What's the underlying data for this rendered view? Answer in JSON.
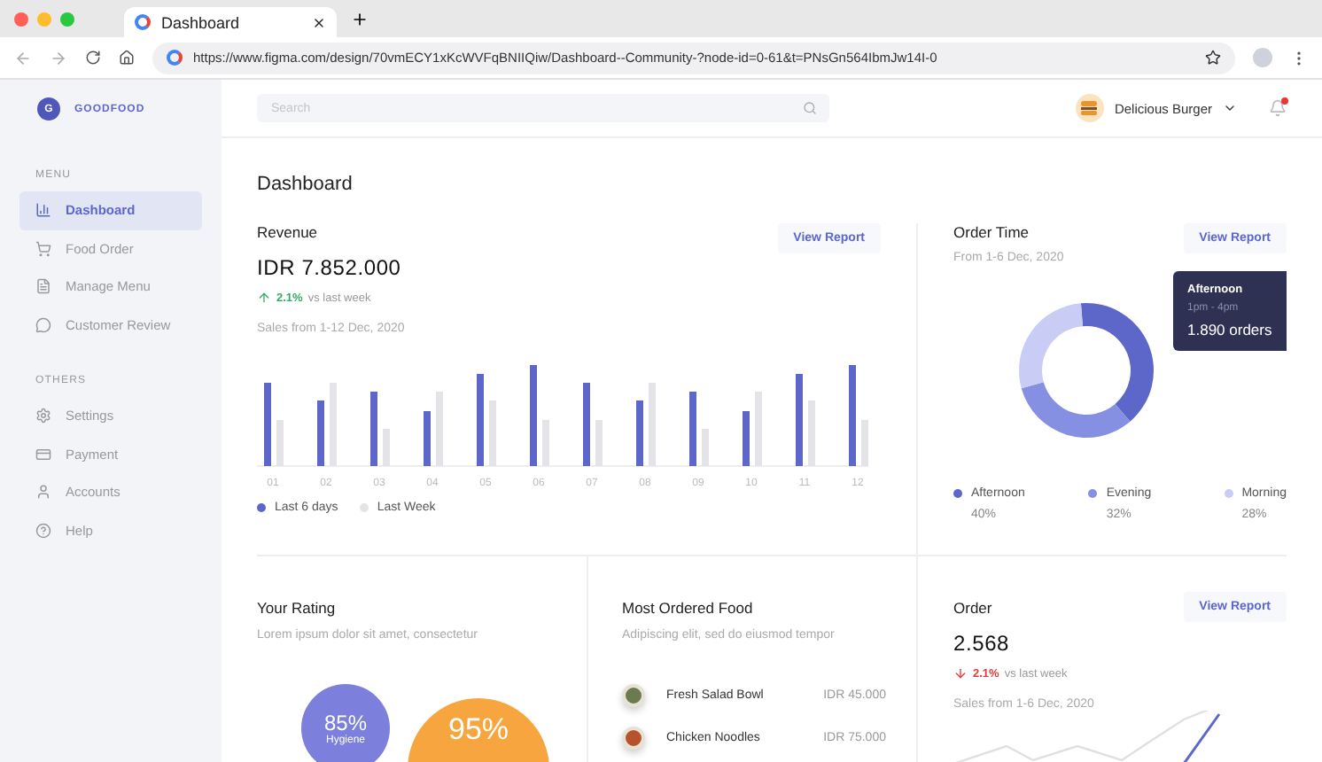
{
  "browser": {
    "tab_title": "Dashboard",
    "url": "https://www.figma.com/design/70vmECY1xKcWVFqBNIIQiw/Dashboard--Community-?node-id=0-61&t=PNsGn564IbmJw14I-0"
  },
  "brand": {
    "initial": "G",
    "name": "GOODFOOD"
  },
  "sidebar": {
    "sections": [
      {
        "heading": "MENU",
        "items": [
          {
            "label": "Dashboard",
            "selected": true
          },
          {
            "label": "Food Order",
            "selected": false
          },
          {
            "label": "Manage Menu",
            "selected": false
          },
          {
            "label": "Customer Review",
            "selected": false
          }
        ]
      },
      {
        "heading": "OTHERS",
        "items": [
          {
            "label": "Settings",
            "selected": false
          },
          {
            "label": "Payment",
            "selected": false
          },
          {
            "label": "Accounts",
            "selected": false
          },
          {
            "label": "Help",
            "selected": false
          }
        ]
      }
    ]
  },
  "header": {
    "search": {
      "placeholder": "Search"
    },
    "user": "Delicious Burger",
    "notification": true
  },
  "page_title": "Dashboard",
  "revenue": {
    "title": "Revenue",
    "amount": "IDR 7.852.000",
    "change": {
      "kind": "up",
      "value": "2.1%",
      "text": "vs last week"
    },
    "period": "Sales from 1-12 Dec, 2020",
    "button": "View Report",
    "x_labels": [
      "01",
      "02",
      "03",
      "04",
      "05",
      "06",
      "07",
      "08",
      "09",
      "10",
      "11",
      "12"
    ],
    "legend": [
      {
        "label": "Last 6 days",
        "color": "#5c67c9"
      },
      {
        "label": "Last Week",
        "color": "#e4e4e8"
      }
    ]
  },
  "order_time": {
    "title": "Order Time",
    "period": "From 1-6 Dec, 2020",
    "button": "View Report",
    "tooltip": {
      "title": "Afternoon",
      "time": "1pm - 4pm",
      "value": "1.890 orders"
    },
    "chart_data": {
      "type": "donut",
      "categories": [
        "Afternoon",
        "Evening",
        "Morning"
      ],
      "values": [
        40,
        32,
        28
      ]
    },
    "legend": [
      {
        "value": "40%",
        "color": "#5c67c9"
      },
      {
        "value": "32%",
        "color": "#8590e3"
      },
      {
        "value": "28%",
        "color": "#c9ccf5"
      }
    ]
  },
  "rating": {
    "title": "Your Rating",
    "subtitle": "Lorem ipsum dolor sit amet, consectetur",
    "bubbles": [
      {
        "value": "85%",
        "label": "Hygiene",
        "color": "#7c7fdb"
      },
      {
        "value": "95%",
        "color": "#f7a53e"
      }
    ]
  },
  "food": {
    "title": "Most Ordered Food",
    "subtitle": "Adipiscing elit, sed do eiusmod tempor",
    "items": [
      {
        "name": "Fresh Salad Bowl",
        "price": "IDR 45.000",
        "color": "#6b7a4f"
      },
      {
        "name": "Chicken Noodles",
        "price": "IDR 75.000",
        "color": "#b5542c"
      }
    ]
  },
  "order": {
    "title": "Order",
    "amount": "2.568",
    "change": {
      "kind": "down",
      "value": "2.1%",
      "text": "vs last week"
    },
    "period": "Sales from 1-6 Dec, 2020",
    "button": "View Report"
  }
}
